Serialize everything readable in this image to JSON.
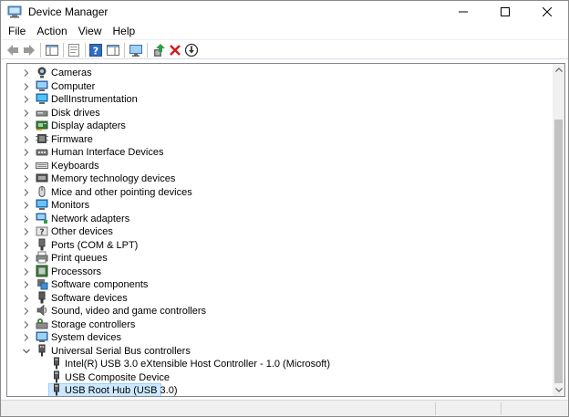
{
  "window": {
    "title": "Device Manager"
  },
  "menu": [
    "File",
    "Action",
    "View",
    "Help"
  ],
  "toolbar": [
    {
      "name": "back-icon",
      "kind": "back"
    },
    {
      "name": "forward-icon",
      "kind": "forward"
    },
    {
      "name": "show-hide-console-tree-icon",
      "kind": "console"
    },
    {
      "name": "properties-icon",
      "kind": "props"
    },
    {
      "name": "help-icon",
      "kind": "help"
    },
    {
      "name": "action-pane-icon",
      "kind": "pane"
    },
    {
      "name": "scan-hardware-changes-icon",
      "kind": "monitor"
    },
    {
      "name": "update-driver-icon",
      "kind": "update"
    },
    {
      "name": "uninstall-device-icon",
      "kind": "uninstall"
    },
    {
      "name": "disable-device-icon",
      "kind": "disable"
    }
  ],
  "tree": [
    {
      "label": "Cameras",
      "icon": "camera-icon",
      "level": 0,
      "expanded": false
    },
    {
      "label": "Computer",
      "icon": "computer-icon",
      "level": 0,
      "expanded": false
    },
    {
      "label": "DellInstrumentation",
      "icon": "monitor-device-icon",
      "level": 0,
      "expanded": false
    },
    {
      "label": "Disk drives",
      "icon": "disk-drive-icon",
      "level": 0,
      "expanded": false
    },
    {
      "label": "Display adapters",
      "icon": "display-adapter-icon",
      "level": 0,
      "expanded": false
    },
    {
      "label": "Firmware",
      "icon": "firmware-icon",
      "level": 0,
      "expanded": false
    },
    {
      "label": "Human Interface Devices",
      "icon": "hid-icon",
      "level": 0,
      "expanded": false
    },
    {
      "label": "Keyboards",
      "icon": "keyboard-icon",
      "level": 0,
      "expanded": false
    },
    {
      "label": "Memory technology devices",
      "icon": "memory-icon",
      "level": 0,
      "expanded": false
    },
    {
      "label": "Mice and other pointing devices",
      "icon": "mouse-icon",
      "level": 0,
      "expanded": false
    },
    {
      "label": "Monitors",
      "icon": "monitor-icon",
      "level": 0,
      "expanded": false
    },
    {
      "label": "Network adapters",
      "icon": "network-adapter-icon",
      "level": 0,
      "expanded": false
    },
    {
      "label": "Other devices",
      "icon": "other-devices-icon",
      "level": 0,
      "expanded": false
    },
    {
      "label": "Ports (COM & LPT)",
      "icon": "port-icon",
      "level": 0,
      "expanded": false
    },
    {
      "label": "Print queues",
      "icon": "printer-icon",
      "level": 0,
      "expanded": false
    },
    {
      "label": "Processors",
      "icon": "processor-icon",
      "level": 0,
      "expanded": false
    },
    {
      "label": "Software components",
      "icon": "software-component-icon",
      "level": 0,
      "expanded": false
    },
    {
      "label": "Software devices",
      "icon": "software-device-icon",
      "level": 0,
      "expanded": false
    },
    {
      "label": "Sound, video and game controllers",
      "icon": "sound-icon",
      "level": 0,
      "expanded": false
    },
    {
      "label": "Storage controllers",
      "icon": "storage-controller-icon",
      "level": 0,
      "expanded": false
    },
    {
      "label": "System devices",
      "icon": "system-devices-icon",
      "level": 0,
      "expanded": false
    },
    {
      "label": "Universal Serial Bus controllers",
      "icon": "usb-controller-icon",
      "level": 0,
      "expanded": true
    },
    {
      "label": "Intel(R) USB 3.0 eXtensible Host Controller - 1.0 (Microsoft)",
      "icon": "usb-plug-icon",
      "level": 1
    },
    {
      "label": "USB Composite Device",
      "icon": "usb-plug-icon",
      "level": 1
    },
    {
      "label": "USB Root Hub (USB 3.0)",
      "icon": "usb-plug-icon",
      "level": 1,
      "selected": true
    }
  ],
  "colors": {
    "selection_bg": "#cce8ff",
    "selection_border": "#99d1ff",
    "scroll_thumb": "#c2c2c2"
  }
}
